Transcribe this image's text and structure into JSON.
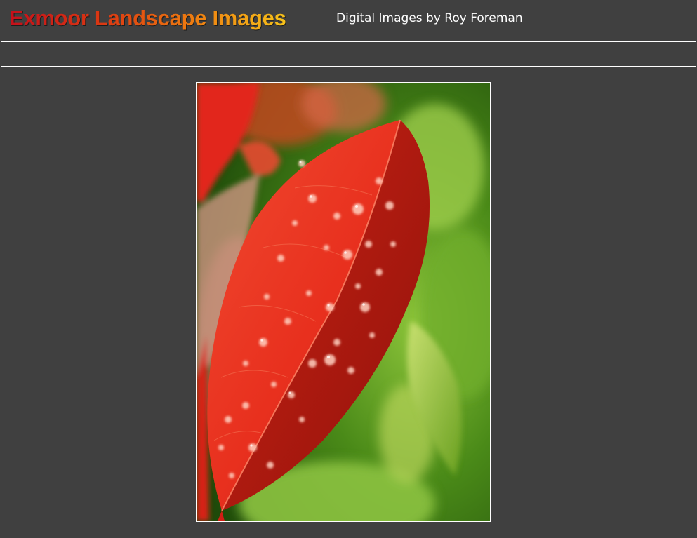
{
  "header": {
    "title": "Exmoor Landscape Images",
    "subtitle": "Digital Images by Roy Foreman"
  },
  "photo": {
    "subject": "red leaf with water droplets",
    "colors": {
      "leaf": "#e0241a",
      "background": "#5a9a1c",
      "page_background": "#404040"
    }
  }
}
